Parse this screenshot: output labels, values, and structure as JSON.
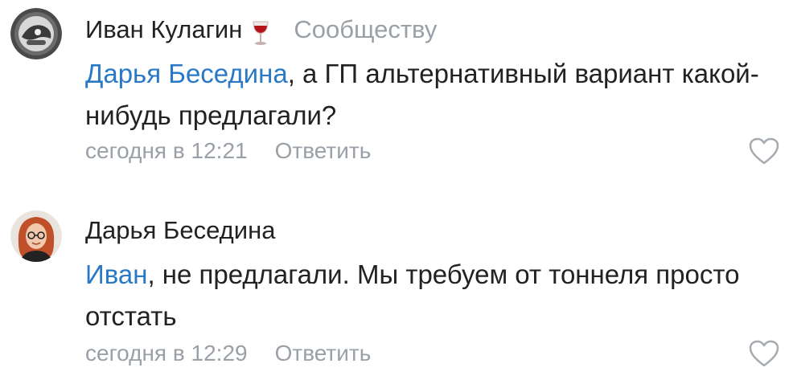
{
  "comments": [
    {
      "author": "Иван Кулагин",
      "badge_icon": "wine-glass-icon",
      "community_label": "Сообществу",
      "mention": "Дарья Беседина",
      "text_rest": ", а ГП альтернативный вариант какой-нибудь предлагали?",
      "timestamp": "сегодня в 12:21",
      "reply_label": "Ответить",
      "like_icon": "heart-outline-icon"
    },
    {
      "author": "Дарья Беседина",
      "mention": "Иван",
      "text_rest": ", не предлагали. Мы требуем от тоннеля просто отстать",
      "timestamp": "сегодня в 12:29",
      "reply_label": "Ответить",
      "like_icon": "heart-outline-icon"
    }
  ],
  "colors": {
    "text": "#222222",
    "muted": "#9aa0a7",
    "mention": "#2a79c6",
    "background": "#ffffff"
  }
}
